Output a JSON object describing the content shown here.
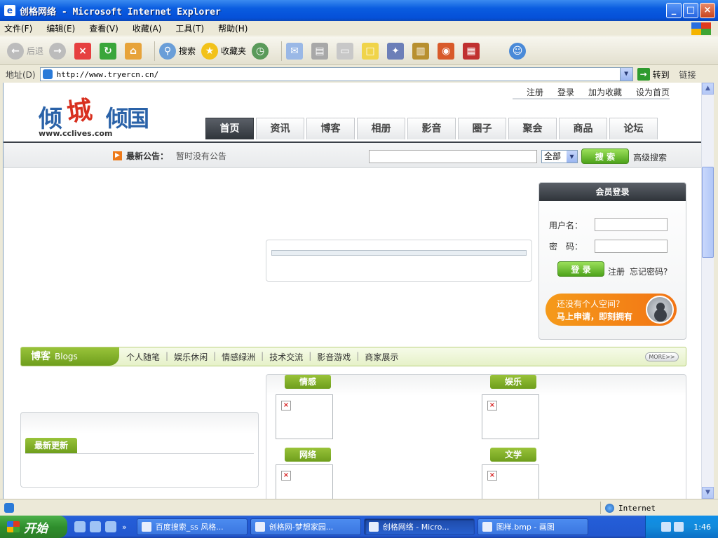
{
  "window": {
    "title": "创格网络 - Microsoft Internet Explorer",
    "min_label": "_",
    "max_label": "□",
    "close_label": "×"
  },
  "menubar": {
    "items": [
      "文件(F)",
      "编辑(E)",
      "查看(V)",
      "收藏(A)",
      "工具(T)",
      "帮助(H)"
    ]
  },
  "toolbar": {
    "back_label": "后退",
    "search_label": "搜索",
    "favorites_label": "收藏夹"
  },
  "address": {
    "label": "地址(D)",
    "url": "http://www.tryercn.cn/",
    "go_label": "转到",
    "links_label": "链接"
  },
  "site": {
    "logo": {
      "char1": "倾",
      "char2": "城",
      "char3": "倾国",
      "url": "www.cclives.com"
    },
    "top_links": [
      "注册",
      "登录",
      "加为收藏",
      "设为首页"
    ],
    "nav_tabs": [
      "首页",
      "资讯",
      "博客",
      "相册",
      "影音",
      "圈子",
      "聚会",
      "商品",
      "论坛"
    ],
    "notice": {
      "label": "最新公告：",
      "text": "暂时没有公告"
    },
    "search": {
      "scope": "全部",
      "button": "搜 索",
      "advanced": "高级搜索"
    },
    "login": {
      "title": "会员登录",
      "username_label": "用户名：",
      "password_label": "密　码：",
      "submit": "登 录",
      "register": "注册",
      "forgot": "忘记密码?",
      "promo_line1": "还没有个人空间？",
      "promo_line2": "马上申请，即刻拥有"
    },
    "blogs": {
      "title": "博客",
      "title_en": "Blogs",
      "categories": [
        "个人随笔",
        "娱乐休闲",
        "情感绿洲",
        "技术交流",
        "影音游戏",
        "商家展示"
      ],
      "more": "MORE>>"
    },
    "latest": {
      "title": "最新更新"
    },
    "category_tabs": [
      "情感",
      "娱乐",
      "网络",
      "文学"
    ]
  },
  "status": {
    "zone": "Internet"
  },
  "taskbar": {
    "start": "开始",
    "tasks": [
      "百度搜索_ss 风格...",
      "创格网-梦想家园...",
      "创格网络 - Micro...",
      "图样.bmp - 画图"
    ],
    "clock": "1:46"
  }
}
